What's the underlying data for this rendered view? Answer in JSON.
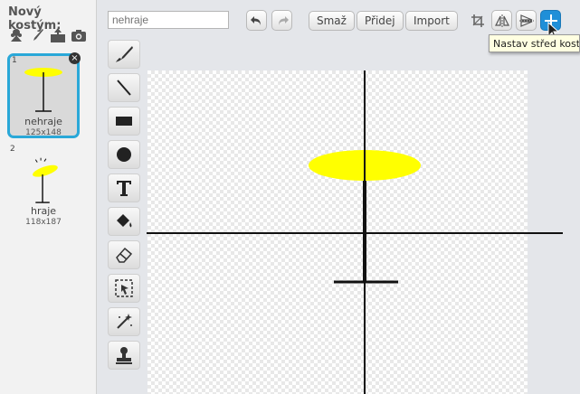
{
  "costumes_panel": {
    "title": "Nový kostým:",
    "tools": [
      "paint-new-icon",
      "brush-icon",
      "upload-icon",
      "camera-icon"
    ],
    "items": [
      {
        "number": "1",
        "name": "nehraje",
        "size": "125x148"
      },
      {
        "number": "2",
        "name": "hraje",
        "size": "118x187"
      }
    ],
    "delete_label": "×"
  },
  "editor": {
    "costume_name_placeholder": "nehraje",
    "buttons": {
      "clear": "Smaž",
      "add": "Přidej",
      "import": "Import"
    },
    "tooltip": "Nastav střed kostýmu",
    "tools": [
      "brush-icon",
      "line-icon",
      "rectangle-icon",
      "ellipse-icon",
      "text-icon",
      "fill-icon",
      "eraser-icon",
      "select-icon",
      "select-remove-background-icon",
      "stamp-icon"
    ]
  },
  "colors": {
    "accent": "#2aa8d8",
    "sprite_yellow": "#ffff00",
    "set_center_button": "#1f8fd8"
  }
}
